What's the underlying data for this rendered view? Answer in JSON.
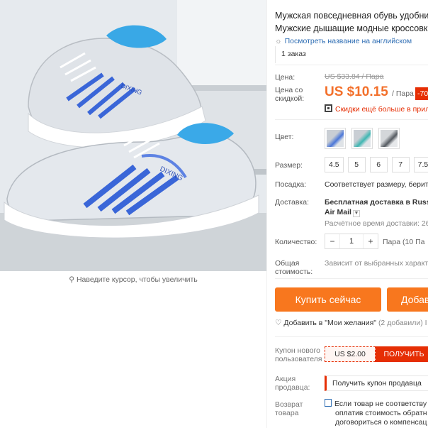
{
  "image": {
    "zoom_hint": "Наведите курсор, чтобы увеличить",
    "brand_print": "DIXING",
    "icon": "magnifier-icon"
  },
  "product": {
    "title_line1": "Мужская повседневная обувь удобни",
    "title_line2": "Мужские дышащие модные кроссовк",
    "translate_link": "Посмотреть название на английском",
    "orders": "1 заказ"
  },
  "price": {
    "label": "Цена:",
    "old": "US $33.84 / Пара",
    "discount_label_l1": "Цена со",
    "discount_label_l2": "скидкой:",
    "new": "US $10.15",
    "unit": "/ Пара",
    "badge": "-70",
    "promo": "Скидки ещё больше в прил"
  },
  "options": {
    "color_label": "Цвет:",
    "colors": [
      "grey-blue",
      "grey-teal",
      "grey-dark"
    ],
    "size_label": "Размер:",
    "sizes": [
      "4.5",
      "5",
      "6",
      "7",
      "7.5"
    ]
  },
  "fit": {
    "label": "Посадка:",
    "value": "Соответствует размеру, берите"
  },
  "shipping": {
    "label": "Доставка:",
    "line1": "Бесплатная доставка в Russi",
    "line2": "Air Mail",
    "eta": "Расчётное время доставки: 26"
  },
  "quantity": {
    "label": "Количество:",
    "value": "1",
    "minus": "−",
    "plus": "+",
    "note": "Пара (10 Па"
  },
  "total": {
    "label_l1": "Общая",
    "label_l2": "стоимость:",
    "value": "Зависит от выбранных характ"
  },
  "actions": {
    "buy": "Купить сейчас",
    "cart": "Добав",
    "wishlist": "Добавить в \"Мои желания\"",
    "wishlist_count": "(2 добавили) I"
  },
  "coupon": {
    "label_l1": "Купон нового",
    "label_l2": "пользователя",
    "value": "US $2.00",
    "button": "ПОЛУЧИТЬ"
  },
  "seller_promo": {
    "label_l1": "Акция",
    "label_l2": "продавца:",
    "value": "Получить купон продавца"
  },
  "returns": {
    "label_l1": "Возврат",
    "label_l2": "товара",
    "line1": "Если товар не соответству",
    "line2": "оплатив стоимость обратн",
    "line3": "договориться о компенсац"
  },
  "colors": {
    "accent": "#f8771e",
    "price": "#f3702b",
    "red": "#e62e04",
    "link": "#2f6eb4"
  }
}
